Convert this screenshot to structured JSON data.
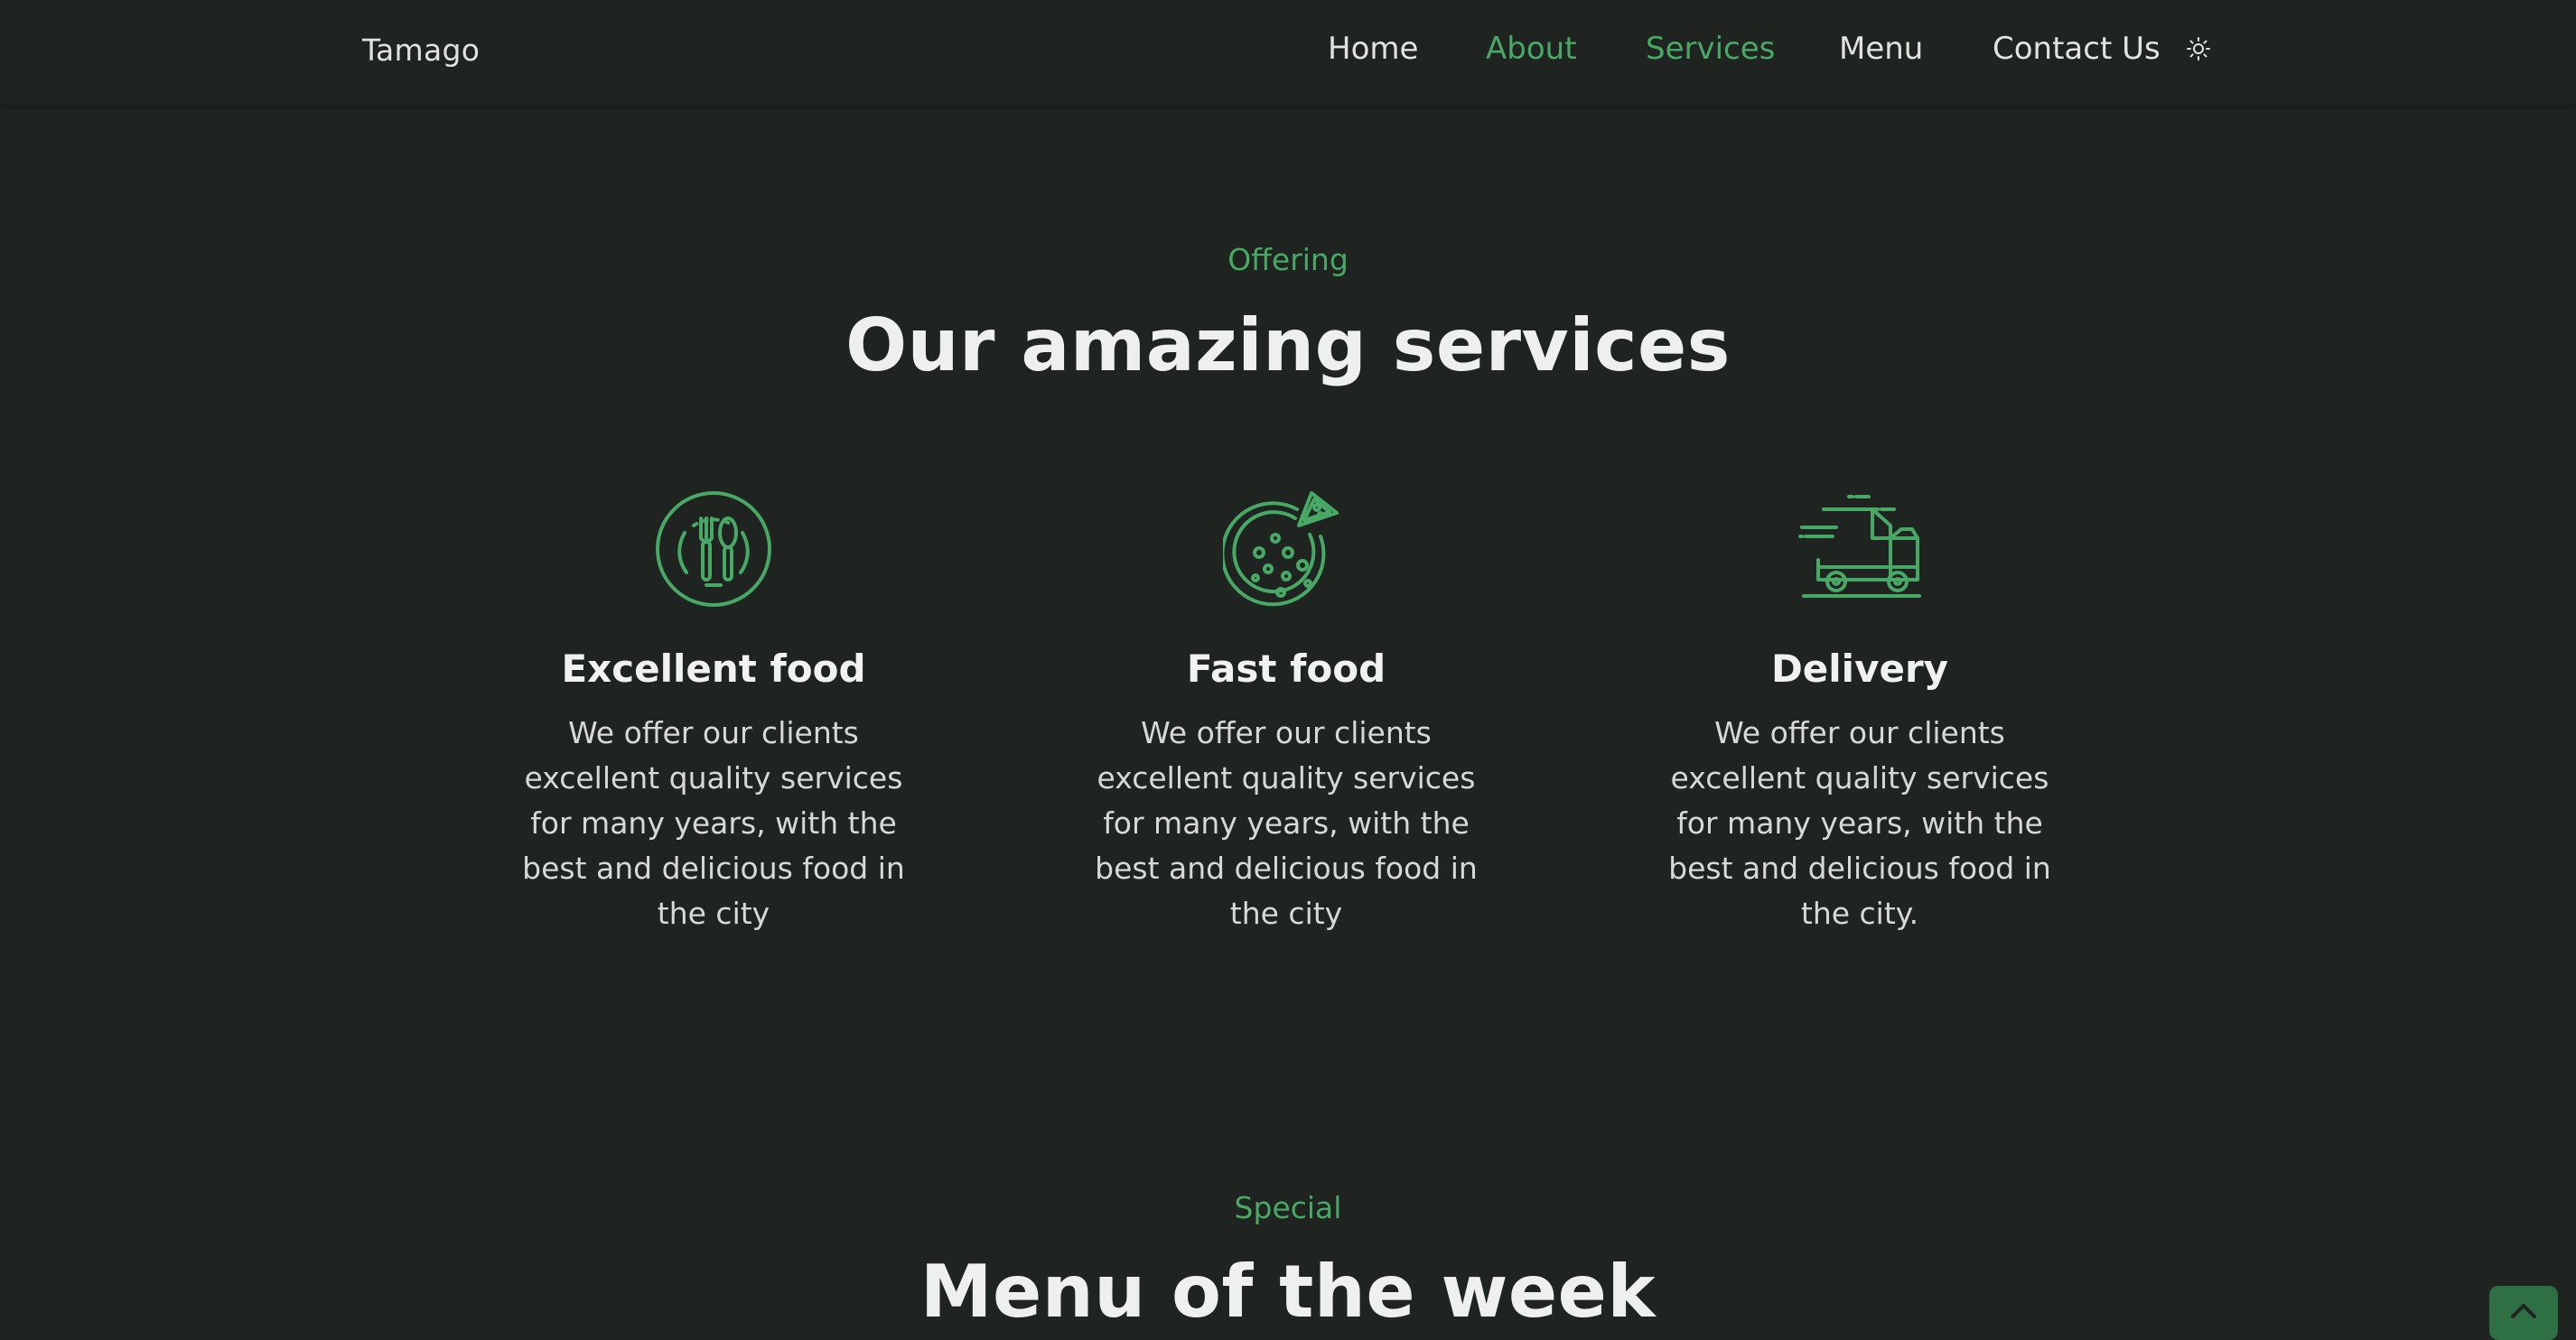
{
  "header": {
    "logo": "Tamago",
    "nav": [
      {
        "label": "Home",
        "active": false
      },
      {
        "label": "About",
        "active": true
      },
      {
        "label": "Services",
        "active": true
      },
      {
        "label": "Menu",
        "active": false
      },
      {
        "label": "Contact Us",
        "active": false
      }
    ],
    "theme_icon": "sun-icon"
  },
  "services": {
    "subtitle": "Offering",
    "title": "Our amazing services",
    "cards": [
      {
        "icon": "utensils-icon",
        "title": "Excellent food",
        "text": "We offer our clients excellent quality services for many years, with the best and delicious food in the city"
      },
      {
        "icon": "pizza-icon",
        "title": "Fast food",
        "text": "We offer our clients excellent quality services for many years, with the best and delicious food in the city"
      },
      {
        "icon": "delivery-truck-icon",
        "title": "Delivery",
        "text": "We offer our clients excellent quality services for many years, with the best and delicious food in the city."
      }
    ]
  },
  "menu_section": {
    "subtitle": "Special",
    "title": "Menu of the week"
  },
  "colors": {
    "background": "#1f2421",
    "accent": "#48a865",
    "text": "#e0e3e0"
  },
  "scroll_up_icon": "chevron-up-icon"
}
